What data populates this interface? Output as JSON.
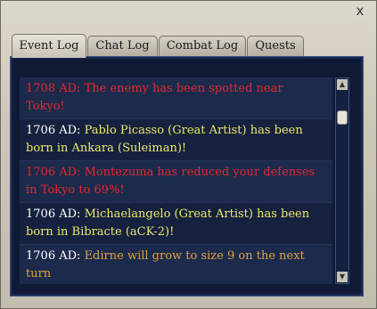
{
  "window": {
    "close_label": "x"
  },
  "tabs": [
    {
      "label": "Event Log",
      "active": true
    },
    {
      "label": "Chat Log",
      "active": false
    },
    {
      "label": "Combat Log",
      "active": false
    },
    {
      "label": "Quests",
      "active": false
    }
  ],
  "entries": [
    {
      "date": "1708 AD:",
      "text": "The enemy has been spotted near Tokyo!",
      "color": "#e4282b"
    },
    {
      "date": "1706 AD:",
      "text": "Pablo Picasso (Great Artist) has been born in Ankara (Suleiman)!",
      "color": "#ece86a"
    },
    {
      "date": "1706 AD:",
      "text": "Montezuma has reduced your defenses in Tokyo to 69%!",
      "color": "#e4282b"
    },
    {
      "date": "1706 AD:",
      "text": "Michaelangelo (Great Artist) has been born in Bibracte (aCK-2)!",
      "color": "#ece86a"
    },
    {
      "date": "1706 AD:",
      "text": "Edirne will grow to size 9 on the next turn",
      "color": "#e1a23a"
    }
  ],
  "scrollbar": {
    "up_icon": "arrow-up-icon",
    "down_icon": "arrow-down-icon"
  }
}
